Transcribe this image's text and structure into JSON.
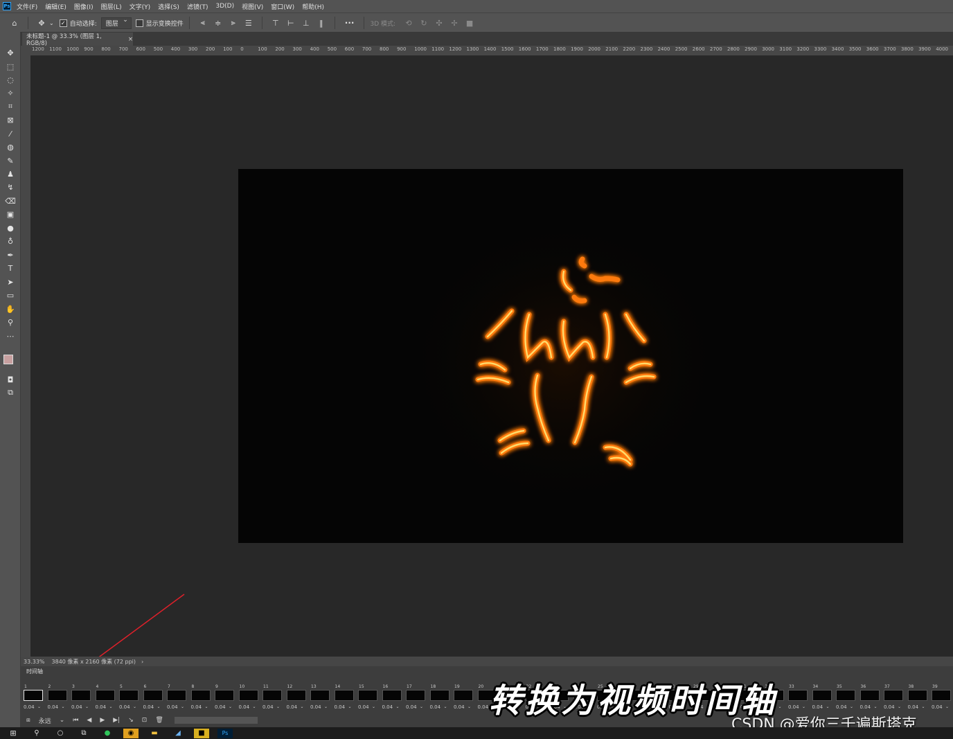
{
  "menubar": {
    "logo": "Ps",
    "items": [
      "文件(F)",
      "编辑(E)",
      "图像(I)",
      "图层(L)",
      "文字(Y)",
      "选择(S)",
      "滤镜(T)",
      "3D(D)",
      "视图(V)",
      "窗口(W)",
      "帮助(H)"
    ]
  },
  "options": {
    "auto_select_label": "自动选择:",
    "auto_select_value": "图层",
    "show_transform_label": "显示变换控件",
    "mode_3d_label": "3D 模式:",
    "more": "···"
  },
  "document": {
    "tab_title": "未标题-1 @ 33.3% (图层 1, RGB/8)",
    "tab_close": "×"
  },
  "ruler": {
    "labels": [
      "1200",
      "1100",
      "1000",
      "900",
      "800",
      "700",
      "600",
      "500",
      "400",
      "300",
      "200",
      "100",
      "0",
      "100",
      "200",
      "300",
      "400",
      "500",
      "600",
      "700",
      "800",
      "900",
      "1000",
      "1100",
      "1200",
      "1300",
      "1400",
      "1500",
      "1600",
      "1700",
      "1800",
      "1900",
      "2000",
      "2100",
      "2200",
      "2300",
      "2400",
      "2500",
      "2600",
      "2700",
      "2800",
      "2900",
      "3000",
      "3100",
      "3200",
      "3300",
      "3400",
      "3500",
      "3600",
      "3700",
      "3800",
      "3900",
      "4000"
    ]
  },
  "status": {
    "zoom": "33.33%",
    "doc_info": "3840 像素 x 2160 像素 (72 ppi)",
    "arrow": "›"
  },
  "timeline": {
    "title": "时间轴",
    "frames": [
      {
        "num": "1",
        "dur": "0.04"
      },
      {
        "num": "2",
        "dur": "0.04"
      },
      {
        "num": "3",
        "dur": "0.04"
      },
      {
        "num": "4",
        "dur": "0.04"
      },
      {
        "num": "5",
        "dur": "0.04"
      },
      {
        "num": "6",
        "dur": "0.04"
      },
      {
        "num": "7",
        "dur": "0.04"
      },
      {
        "num": "8",
        "dur": "0.04"
      },
      {
        "num": "9",
        "dur": "0.04"
      },
      {
        "num": "10",
        "dur": "0.04"
      },
      {
        "num": "11",
        "dur": "0.04"
      },
      {
        "num": "12",
        "dur": "0.04"
      },
      {
        "num": "13",
        "dur": "0.04"
      },
      {
        "num": "14",
        "dur": "0.04"
      },
      {
        "num": "15",
        "dur": "0.04"
      },
      {
        "num": "16",
        "dur": "0.04"
      },
      {
        "num": "17",
        "dur": "0.04"
      },
      {
        "num": "18",
        "dur": "0.04"
      },
      {
        "num": "19",
        "dur": "0.04"
      },
      {
        "num": "20",
        "dur": "0.04"
      },
      {
        "num": "21",
        "dur": "0.04"
      },
      {
        "num": "22",
        "dur": "0.04"
      },
      {
        "num": "23",
        "dur": "0.04"
      },
      {
        "num": "24",
        "dur": "0.04"
      },
      {
        "num": "25",
        "dur": "0.04"
      },
      {
        "num": "26",
        "dur": "0.04"
      },
      {
        "num": "27",
        "dur": "0.04"
      },
      {
        "num": "28",
        "dur": "0.04"
      },
      {
        "num": "29",
        "dur": "0.04"
      },
      {
        "num": "30",
        "dur": "0.04"
      },
      {
        "num": "31",
        "dur": "0.04"
      },
      {
        "num": "32",
        "dur": "0.04"
      },
      {
        "num": "33",
        "dur": "0.04"
      },
      {
        "num": "34",
        "dur": "0.04"
      },
      {
        "num": "35",
        "dur": "0.04"
      },
      {
        "num": "36",
        "dur": "0.04"
      },
      {
        "num": "37",
        "dur": "0.04"
      },
      {
        "num": "38",
        "dur": "0.04"
      },
      {
        "num": "39",
        "dur": "0.04"
      }
    ],
    "loop_value": "永远"
  },
  "caption": "转换为视频时间轴",
  "watermark": "CSDN @爱你三千遍斯塔克",
  "colors": {
    "glow_core": "#ffd24a",
    "glow_outer": "#ff6a00",
    "annotation_arrow": "#e0202a",
    "foreground_swatch": "#c8a0a0",
    "background_swatch": "#1a2a4a"
  }
}
